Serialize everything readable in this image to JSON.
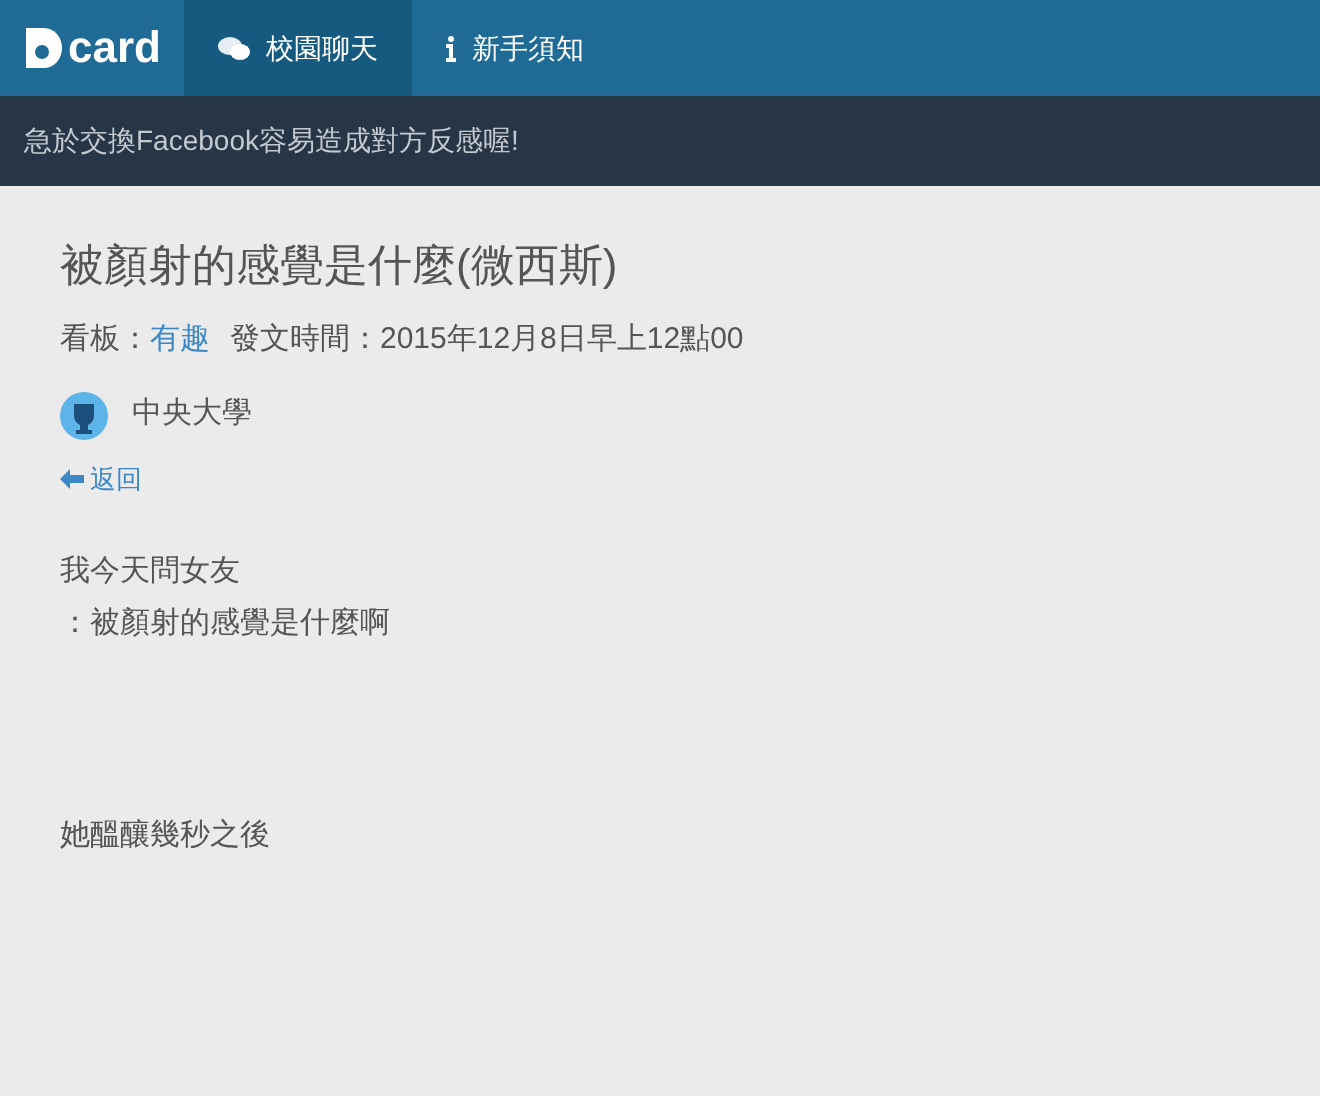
{
  "nav": {
    "logo": "card",
    "tabs": [
      {
        "label": "校園聊天",
        "kind": "chat",
        "selected": true
      },
      {
        "label": "新手須知",
        "kind": "info",
        "selected": false
      }
    ]
  },
  "notice": "急於交換Facebook容易造成對方反感喔!",
  "post": {
    "title": "被顏射的感覺是什麼(微西斯)",
    "board_label": "看板：",
    "board": "有趣",
    "time_label": "發文時間：",
    "time": "2015年12月8日早上12點00",
    "author": "中央大學",
    "back": "返回",
    "paragraphs": [
      [
        "我今天問女友",
        "：被顏射的感覺是什麼啊"
      ],
      [
        "她醞釀幾秒之後"
      ]
    ]
  }
}
